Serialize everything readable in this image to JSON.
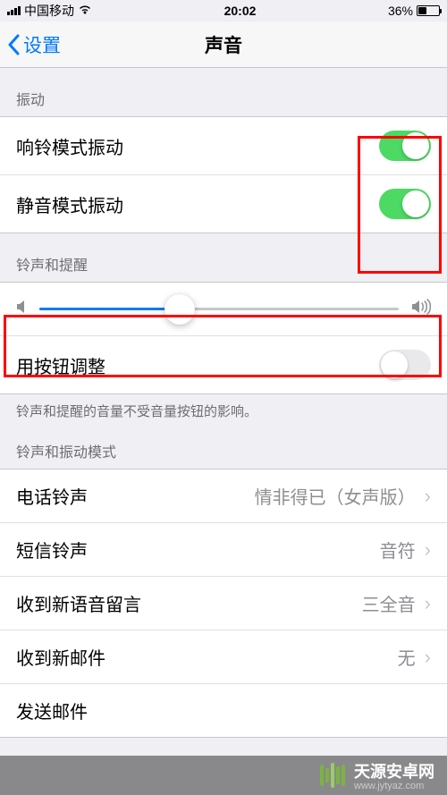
{
  "status_bar": {
    "carrier": "中国移动",
    "time": "20:02",
    "battery_pct": "36%"
  },
  "nav": {
    "back_label": "设置",
    "title": "声音"
  },
  "vibration": {
    "header": "振动",
    "ring_vibrate_label": "响铃模式振动",
    "ring_vibrate_on": true,
    "silent_vibrate_label": "静音模式振动",
    "silent_vibrate_on": true
  },
  "ringer": {
    "header": "铃声和提醒",
    "volume_pct": 39,
    "button_adjust_label": "用按钮调整",
    "button_adjust_on": false,
    "footer": "铃声和提醒的音量不受音量按钮的影响。"
  },
  "patterns": {
    "header": "铃声和振动模式",
    "items": [
      {
        "label": "电话铃声",
        "value": "情非得已（女声版）"
      },
      {
        "label": "短信铃声",
        "value": "音符"
      },
      {
        "label": "收到新语音留言",
        "value": "三全音"
      },
      {
        "label": "收到新邮件",
        "value": "无"
      },
      {
        "label": "发送邮件",
        "value": ""
      }
    ]
  },
  "watermark": {
    "name": "天源安卓网",
    "url": "www.jytyaz.com"
  },
  "colors": {
    "accent": "#007aff",
    "toggle_on": "#4cd964",
    "annotation": "#ff0000"
  }
}
